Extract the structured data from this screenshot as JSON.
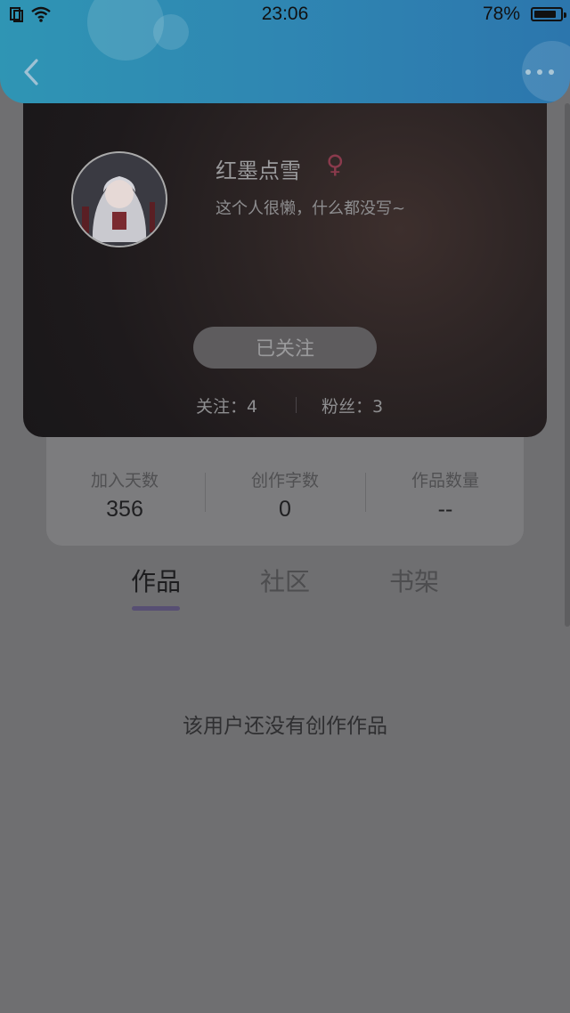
{
  "status_bar": {
    "time": "23:06",
    "battery_pct": "78%"
  },
  "profile": {
    "username": "红墨点雪",
    "gender_symbol": "♀",
    "bio": "这个人很懒，什么都没写~",
    "follow_button": "已关注",
    "following": "关注：4",
    "fans": "粉丝：3"
  },
  "stats": [
    {
      "label": "加入天数",
      "value": "356"
    },
    {
      "label": "创作字数",
      "value": "0"
    },
    {
      "label": "作品数量",
      "value": "--"
    }
  ],
  "tabs": [
    {
      "label": "作品",
      "active": true
    },
    {
      "label": "社区",
      "active": false
    },
    {
      "label": "书架",
      "active": false
    }
  ],
  "empty_message": "该用户还没有创作作品",
  "colors": {
    "header": "#2f86b2",
    "accent_underline": "#574f73",
    "gender": "#8a3a4c"
  }
}
